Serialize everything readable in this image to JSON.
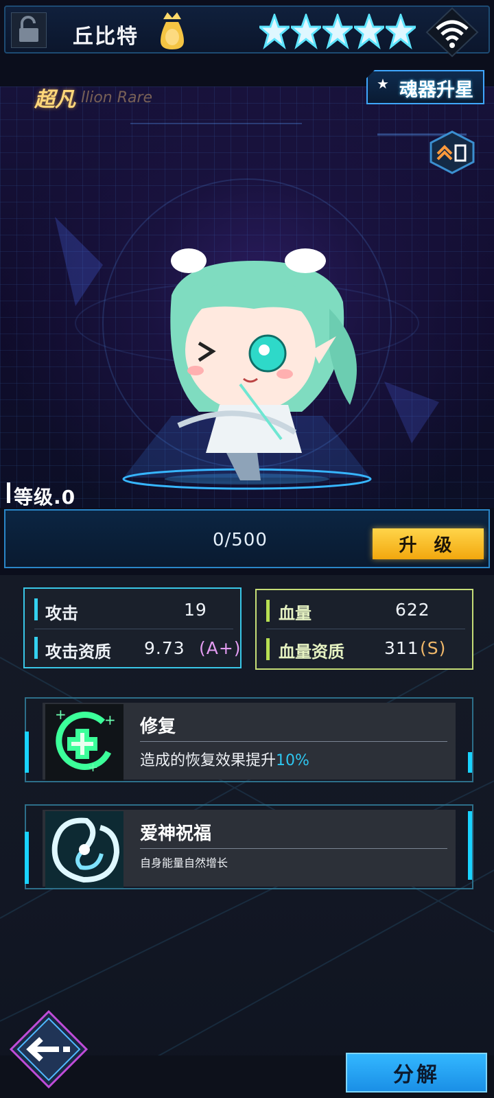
{
  "header": {
    "hero_name": "丘比特",
    "star_count": 5,
    "icons": [
      "unlock-icon",
      "crown-icon",
      "star-icon",
      "wifi-icon"
    ]
  },
  "scene": {
    "rarity_label": "超凡",
    "rarity_en": "llion Rare",
    "star_upgrade_label": "魂器升星",
    "level_label": "等级.0"
  },
  "exp": {
    "progress_text": "0/500",
    "progress_fraction": 0.0,
    "upgrade_label": "升 级"
  },
  "stats": {
    "attack_label": "攻击",
    "attack_value": "19",
    "attack_quality_label": "攻击资质",
    "attack_quality_value": "9.73",
    "attack_quality_grade": "(A+)",
    "hp_label": "血量",
    "hp_value": "622",
    "hp_quality_label": "血量资质",
    "hp_quality_value": "311",
    "hp_quality_grade": "(S)"
  },
  "skills": [
    {
      "name": "修复",
      "desc_prefix": "造成的恢复效果提升",
      "desc_highlight": "10%",
      "icon": "heal-cross-icon"
    },
    {
      "name": "爱神祝福",
      "desc": "自身能量自然增长",
      "icon": "swirl-icon"
    }
  ],
  "footer": {
    "decompose_label": "分解"
  },
  "colors": {
    "accent_cyan": "#19d3ff",
    "upgrade_yellow": "#ffd54a",
    "hp_green": "#b7df53",
    "grade_a": "#e49cf2",
    "grade_s": "#f0b86a"
  }
}
